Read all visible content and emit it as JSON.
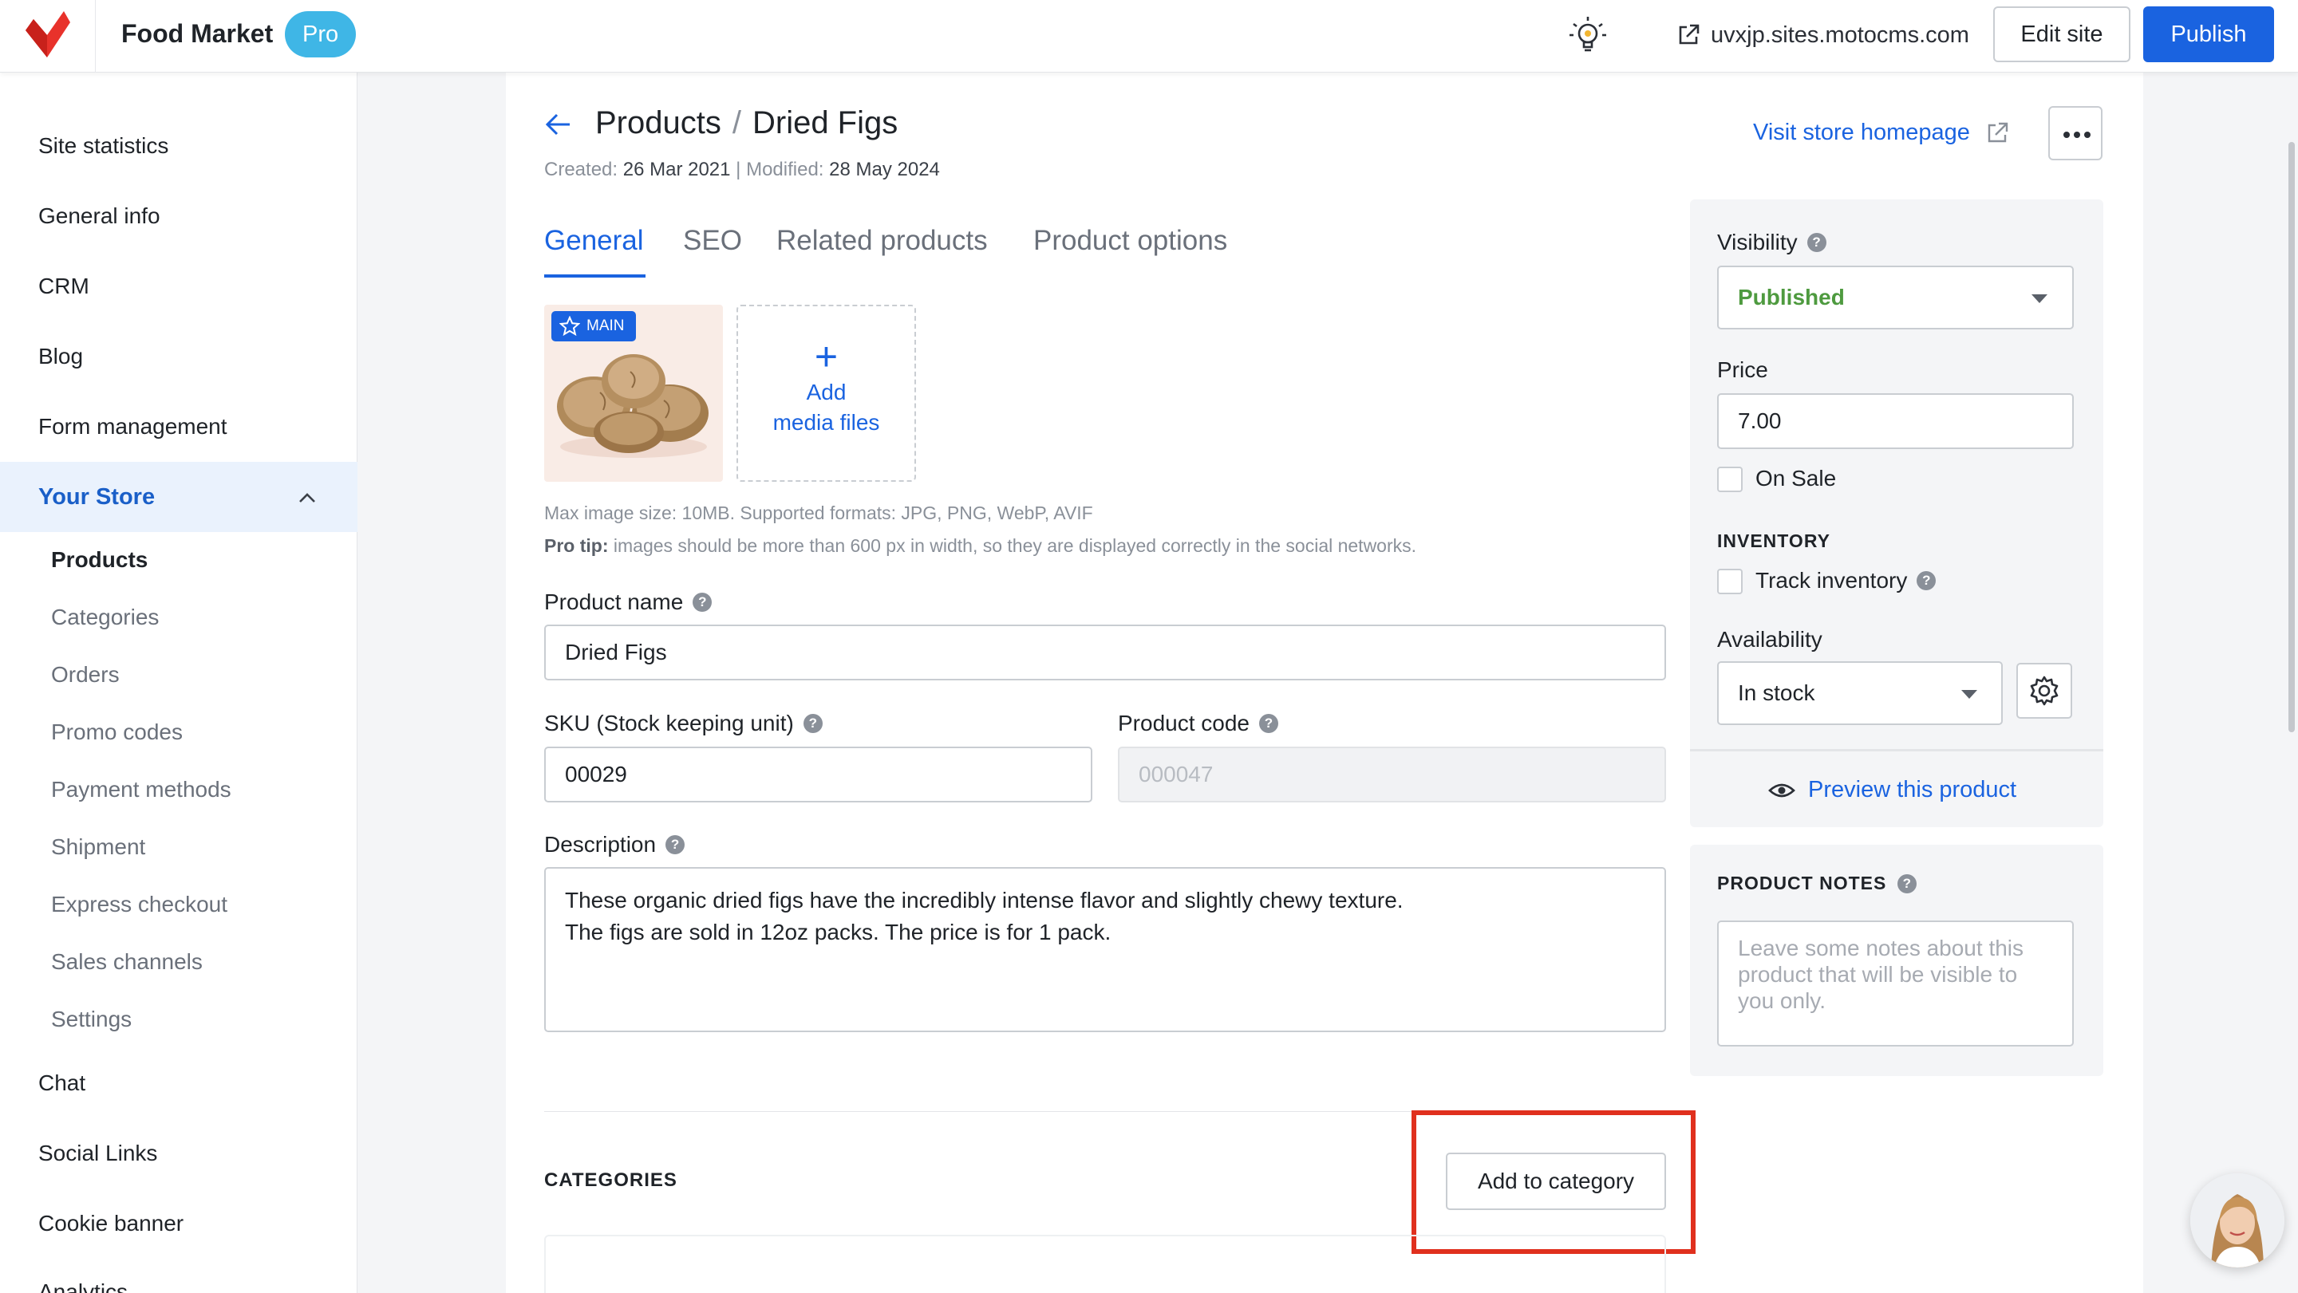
{
  "header": {
    "brand_name": "Food Market",
    "plan_badge": "Pro",
    "site_url": "uvxjp.sites.motocms.com",
    "edit_site_label": "Edit site",
    "publish_label": "Publish",
    "brand_color": "#1a63e0",
    "logo_color": "#e8322b"
  },
  "sidebar": {
    "items": [
      {
        "label": "Site statistics"
      },
      {
        "label": "General info"
      },
      {
        "label": "CRM"
      },
      {
        "label": "Blog"
      },
      {
        "label": "Form management"
      }
    ],
    "store": {
      "label": "Your Store",
      "sub_items": [
        {
          "label": "Products",
          "active": true
        },
        {
          "label": "Categories"
        },
        {
          "label": "Orders"
        },
        {
          "label": "Promo codes"
        },
        {
          "label": "Payment methods"
        },
        {
          "label": "Shipment"
        },
        {
          "label": "Express checkout"
        },
        {
          "label": "Sales channels"
        },
        {
          "label": "Settings"
        }
      ]
    },
    "bottom_items": [
      {
        "label": "Chat"
      },
      {
        "label": "Social Links"
      },
      {
        "label": "Cookie banner"
      },
      {
        "label": "Analytics"
      }
    ]
  },
  "page": {
    "breadcrumb_parent": "Products",
    "breadcrumb_current": "Dried Figs",
    "created_label": "Created:",
    "created_date": "26 Mar 2021",
    "modified_label": "| Modified:",
    "modified_date": "28 May 2024",
    "visit_store_label": "Visit store homepage",
    "tabs": [
      {
        "label": "General",
        "active": true
      },
      {
        "label": "SEO"
      },
      {
        "label": "Related products"
      },
      {
        "label": "Product options"
      }
    ],
    "main_badge": "MAIN",
    "add_media_line1": "Add",
    "add_media_line2": "media files",
    "max_size_hint": "Max image size: 10MB. Supported formats: JPG, PNG, WebP, AVIF",
    "pro_tip_label": "Pro tip:",
    "pro_tip_text": " images should be more than 600 px in width, so they are displayed correctly in the social networks.",
    "product_name_label": "Product name",
    "product_name_value": "Dried Figs",
    "sku_label": "SKU (Stock keeping unit)",
    "sku_value": "00029",
    "product_code_label": "Product code",
    "product_code_placeholder": "000047",
    "description_label": "Description",
    "description_line1": "These organic dried figs have the incredibly intense flavor and slightly chewy texture.",
    "description_line2": "The figs are sold in 12oz packs. The price is for 1 pack.",
    "categories_title": "CATEGORIES",
    "add_to_category_label": "Add to category"
  },
  "right_panel": {
    "visibility_label": "Visibility",
    "visibility_value": "Published",
    "visibility_color": "#4e9a3f",
    "price_label": "Price",
    "price_value": "7.00",
    "on_sale_label": "On Sale",
    "inventory_title": "INVENTORY",
    "track_inventory_label": "Track inventory",
    "availability_label": "Availability",
    "availability_value": "In stock",
    "preview_label": "Preview this product",
    "notes_title": "PRODUCT NOTES",
    "notes_placeholder": "Leave some notes about this product that will be visible to you only."
  },
  "icons": {
    "logo": "motocms-logo-icon",
    "bulb": "lightbulb-icon",
    "external": "external-link-icon",
    "back": "arrow-left-icon",
    "more": "more-dots-icon",
    "star": "star-icon",
    "plus": "plus-icon",
    "gear": "gear-icon",
    "eye": "eye-icon",
    "help": "help-icon",
    "chevron": "chevron-up-icon",
    "caret": "caret-down-icon"
  },
  "help_mark": "?"
}
